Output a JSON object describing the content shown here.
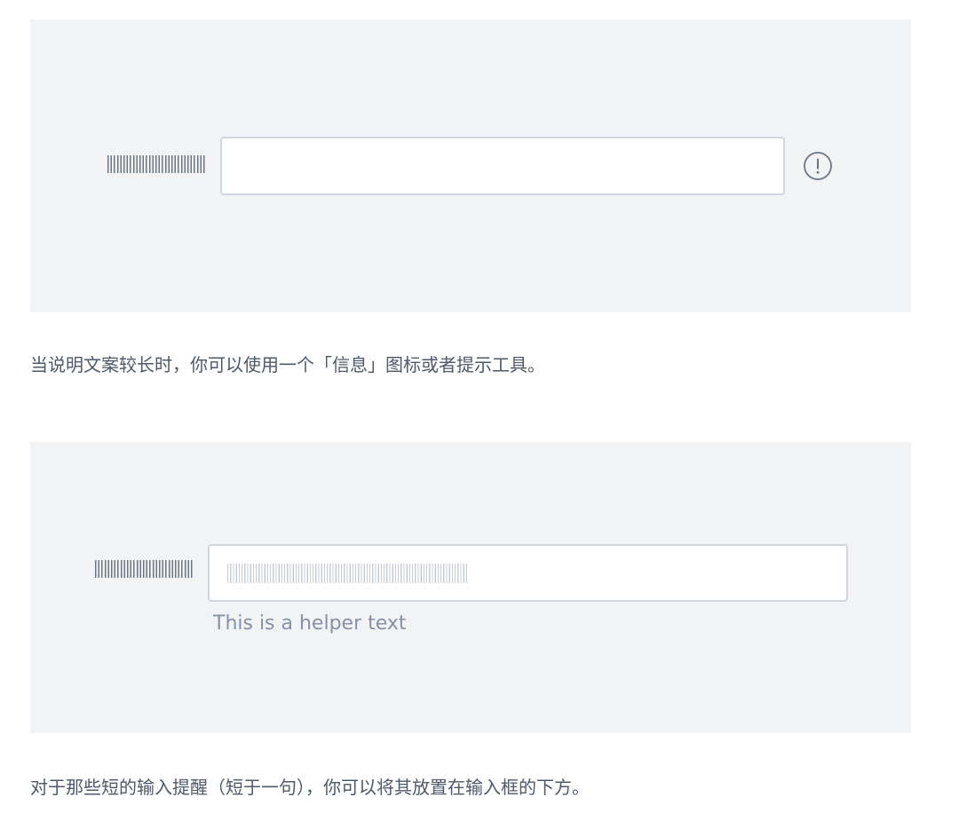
{
  "examples": [
    {
      "field_label": "",
      "field_value": "",
      "icon": "info-circle-icon",
      "caption": "当说明文案较长时，你可以使用一个「信息」图标或者提示工具。"
    },
    {
      "field_label": "",
      "field_value": "",
      "helper_text": "This is a helper text",
      "caption": "对于那些短的输入提醒（短于一句），你可以将其放置在输入框的下方。"
    }
  ],
  "colors": {
    "panel_background": "#f2f3f5",
    "field_border": "#d0d6dd",
    "helper_text": "#8592a6",
    "caption_text": "#4e5969",
    "icon_stroke": "#6b7785"
  }
}
